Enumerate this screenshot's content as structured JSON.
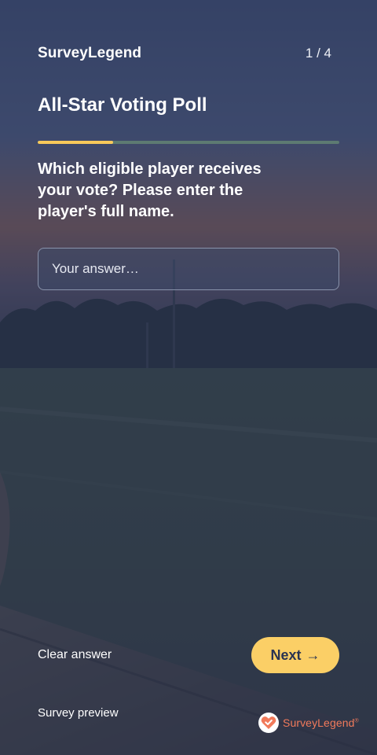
{
  "header": {
    "brand": "SurveyLegend",
    "progress_count": "1 / 4",
    "progress_fraction": 0.25
  },
  "survey": {
    "title": "All-Star Voting Poll",
    "question": "Which eligible player receives your vote? Please enter the player's full name.",
    "answer_value": "",
    "answer_placeholder": "Your answer…"
  },
  "actions": {
    "clear_label": "Clear answer",
    "next_label": "Next",
    "next_arrow": "→"
  },
  "footer": {
    "preview_label": "Survey preview",
    "logo_text": "SurveyLegend",
    "logo_mark": "®"
  },
  "colors": {
    "accent": "#fbcf66",
    "progress_track": "#5d7a72",
    "logo_brand": "#f17a5b",
    "overlay": "#283456"
  }
}
